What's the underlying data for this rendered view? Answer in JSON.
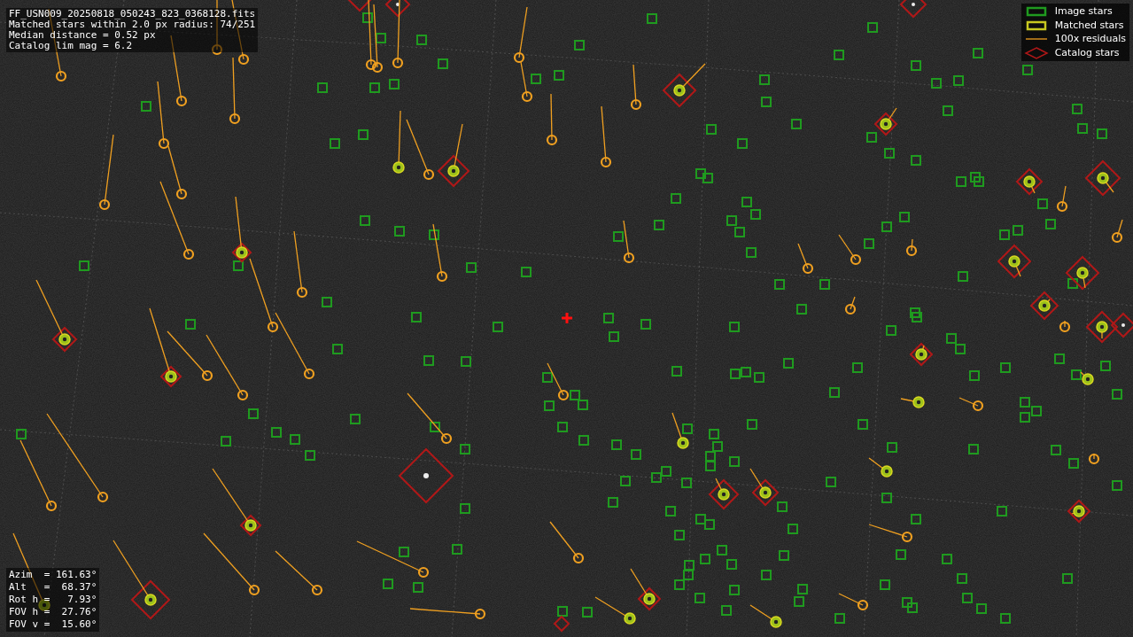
{
  "header_lines": [
    "FF_USN009_20250818_050243_823_0368128.fits",
    "Matched stars within 2.0 px radius: 74/251",
    "Median distance = 0.52 px",
    "Catalog lim mag = 6.2"
  ],
  "legend": [
    {
      "kind": "image",
      "label": "Image stars"
    },
    {
      "kind": "matched",
      "label": "Matched stars"
    },
    {
      "kind": "residual",
      "label": "100x residuals"
    },
    {
      "kind": "catalog",
      "label": "Catalog stars"
    }
  ],
  "pointing": [
    "Azim  = 161.63°",
    "Alt   =  68.37°",
    "Rot h =   7.93°",
    "FOV h =  27.76°",
    "FOV v =  15.60°"
  ]
}
